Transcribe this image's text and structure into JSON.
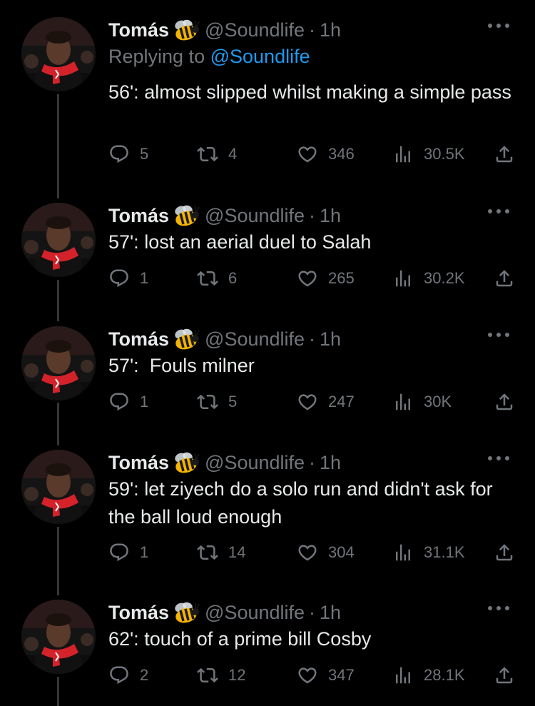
{
  "author": {
    "name": "Tomás",
    "emoji_icon": "bee-icon",
    "handle": "@Soundlife",
    "separator": "·",
    "time": "1h"
  },
  "replying": {
    "prefix": "Replying to",
    "handle": "@Soundlife"
  },
  "icons": {
    "reply": "reply-icon",
    "retweet": "retweet-icon",
    "like": "heart-icon",
    "views": "views-icon",
    "share": "share-icon",
    "more": "more-icon"
  },
  "colors": {
    "background": "#000000",
    "text": "#e7e9ea",
    "muted": "#71767b",
    "link": "#1d9bf0"
  },
  "tweets": [
    {
      "text": "56': almost slipped whilst making a simple pass",
      "replies": "5",
      "retweets": "4",
      "likes": "346",
      "views": "30.5K"
    },
    {
      "text": "57': lost an aerial duel to Salah",
      "replies": "1",
      "retweets": "6",
      "likes": "265",
      "views": "30.2K"
    },
    {
      "text": "57':  Fouls milner",
      "replies": "1",
      "retweets": "5",
      "likes": "247",
      "views": "30K"
    },
    {
      "text": "59': let ziyech do a solo run and didn't ask for the ball loud enough",
      "replies": "1",
      "retweets": "14",
      "likes": "304",
      "views": "31.1K"
    },
    {
      "text": "62': touch of a prime bill Cosby",
      "replies": "2",
      "retweets": "12",
      "likes": "347",
      "views": "28.1K"
    }
  ]
}
